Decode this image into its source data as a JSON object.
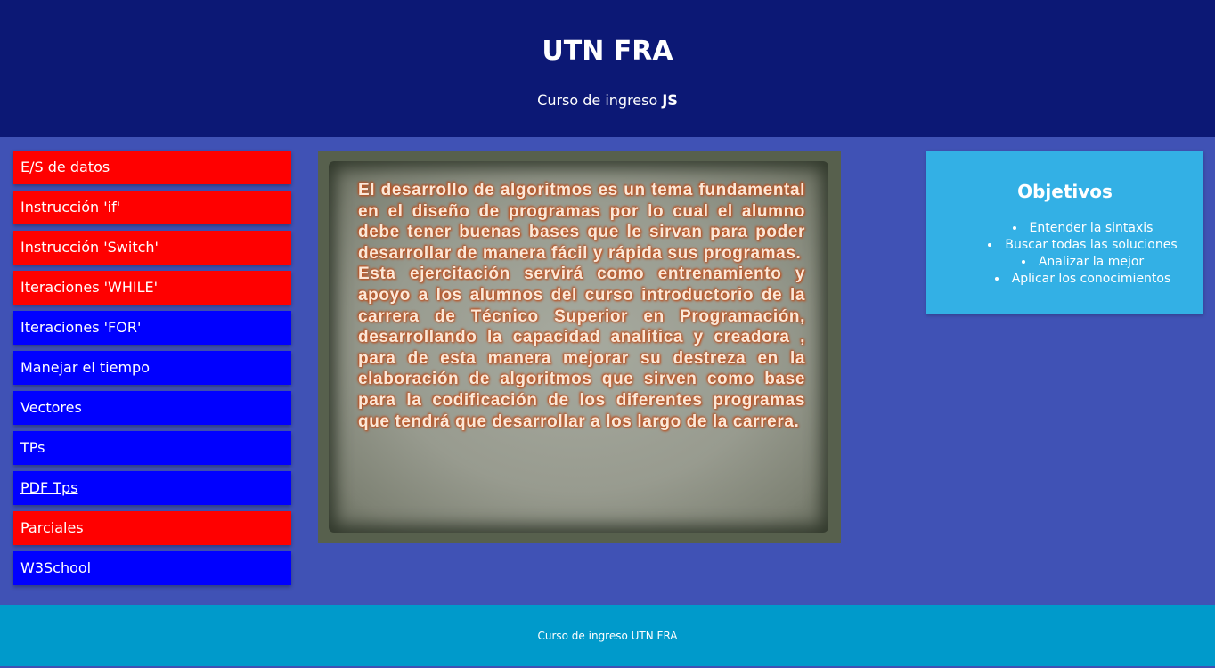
{
  "header": {
    "title": "UTN FRA",
    "subtitle_text": "Curso de ingreso ",
    "subtitle_bold": "JS"
  },
  "sidebar": {
    "items": [
      {
        "label": "E/S de datos",
        "color": "#ff0000",
        "link": false
      },
      {
        "label": "Instrucción 'if'",
        "color": "#ff0000",
        "link": false
      },
      {
        "label": "Instrucción 'Switch'",
        "color": "#ff0000",
        "link": false
      },
      {
        "label": "Iteraciones 'WHILE'",
        "color": "#ff0000",
        "link": false
      },
      {
        "label": "Iteraciones 'FOR'",
        "color": "#0000ff",
        "link": false
      },
      {
        "label": "Manejar el tiempo",
        "color": "#0000ff",
        "link": false
      },
      {
        "label": "Vectores",
        "color": "#0000ff",
        "link": false
      },
      {
        "label": "TPs",
        "color": "#0000ff",
        "link": false
      },
      {
        "label": "PDF Tps",
        "color": "#0000ff",
        "link": true
      },
      {
        "label": "Parciales",
        "color": "#ff0000",
        "link": false
      },
      {
        "label": "W3School",
        "color": "#0000ff",
        "link": true
      }
    ]
  },
  "main": {
    "paragraphs": [
      "El desarrollo de algoritmos es un tema fundamental en el diseño de programas por lo cual el alumno debe tener buenas bases que le sirvan para poder desarrollar de manera fácil y rápida sus programas.",
      "Esta ejercitación servirá como entrenamiento y apoyo a los alumnos del curso introductorio de la carrera de Técnico Superior en Programación, desarrollando la capacidad analítica y creadora , para de esta manera mejorar su destreza en la elaboración de algoritmos que sirven como base para la codificación de los diferentes programas que tendrá que desarrollar a los largo de la carrera."
    ]
  },
  "objectives": {
    "title": "Objetivos",
    "items": [
      "Entender la sintaxis",
      "Buscar todas las soluciones",
      "Analizar la mejor",
      "Aplicar los conocimientos"
    ]
  },
  "footer": {
    "text": "Curso de ingreso UTN FRA"
  },
  "colors": {
    "header_bg": "#0c1875",
    "body_bg": "#4052b5",
    "objectives_bg": "#33b0e5",
    "footer_bg": "#009acb",
    "nav_red": "#ff0000",
    "nav_blue": "#0000ff"
  }
}
